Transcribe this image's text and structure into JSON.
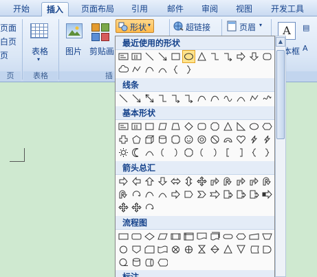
{
  "tabs": [
    "开始",
    "插入",
    "页面布局",
    "引用",
    "邮件",
    "审阅",
    "视图",
    "开发工具"
  ],
  "ribbon": {
    "left_cut_1": "页面",
    "left_cut_2": "白页",
    "left_cut_3": "页",
    "table_label": "表格",
    "table_group": "表格",
    "picture_label": "图片",
    "clipart_label": "剪贴画",
    "illus_group_cut": "插",
    "shapes_label": "形状",
    "hyperlink_label": "超链接",
    "header_label": "页眉",
    "textbox_label": "文本框"
  },
  "dropdown": {
    "sections": [
      {
        "title": "最近使用的形状"
      },
      {
        "title": "线条"
      },
      {
        "title": "基本形状"
      },
      {
        "title": "箭头总汇"
      },
      {
        "title": "流程图"
      },
      {
        "title": "标注"
      }
    ]
  },
  "colors": {
    "ribbon_text": "#15428b",
    "selected_shape": "#ffe38c",
    "document_bg": "#cfe9d0"
  }
}
